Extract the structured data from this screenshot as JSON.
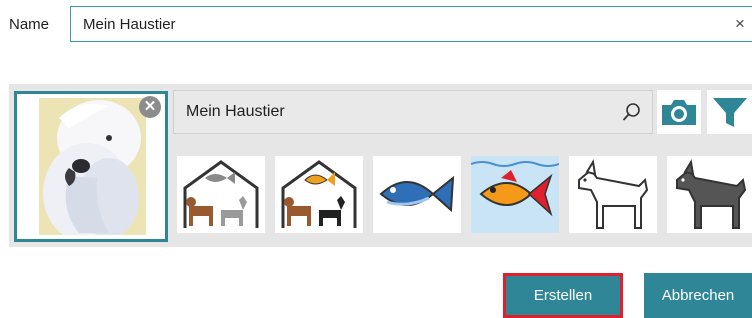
{
  "name_field": {
    "label": "Name",
    "value": "Mein Haustier",
    "clear_glyph": "×"
  },
  "selected_image": {
    "remove_glyph": "✕",
    "icon": "close-circle-icon"
  },
  "search": {
    "value": "Mein Haustier",
    "icon": "search-icon"
  },
  "toolbar": {
    "camera_icon": "camera-icon",
    "filter_icon": "filter-icon"
  },
  "symbols": [
    {
      "icon": "pets-house-gray-fish-icon",
      "selected": false
    },
    {
      "icon": "pets-house-goldfish-icon",
      "selected": false
    },
    {
      "icon": "blue-fish-icon",
      "selected": false
    },
    {
      "icon": "goldfish-icon",
      "selected": true
    },
    {
      "icon": "white-dog-icon",
      "selected": false
    },
    {
      "icon": "gray-dog-icon",
      "selected": false
    }
  ],
  "actions": {
    "create_label": "Erstellen",
    "cancel_label": "Abbrechen"
  },
  "colors": {
    "accent": "#2f8696",
    "highlight": "#e0202c",
    "panel": "#e6e6e6",
    "selected_tile": "#c9e4f5"
  }
}
